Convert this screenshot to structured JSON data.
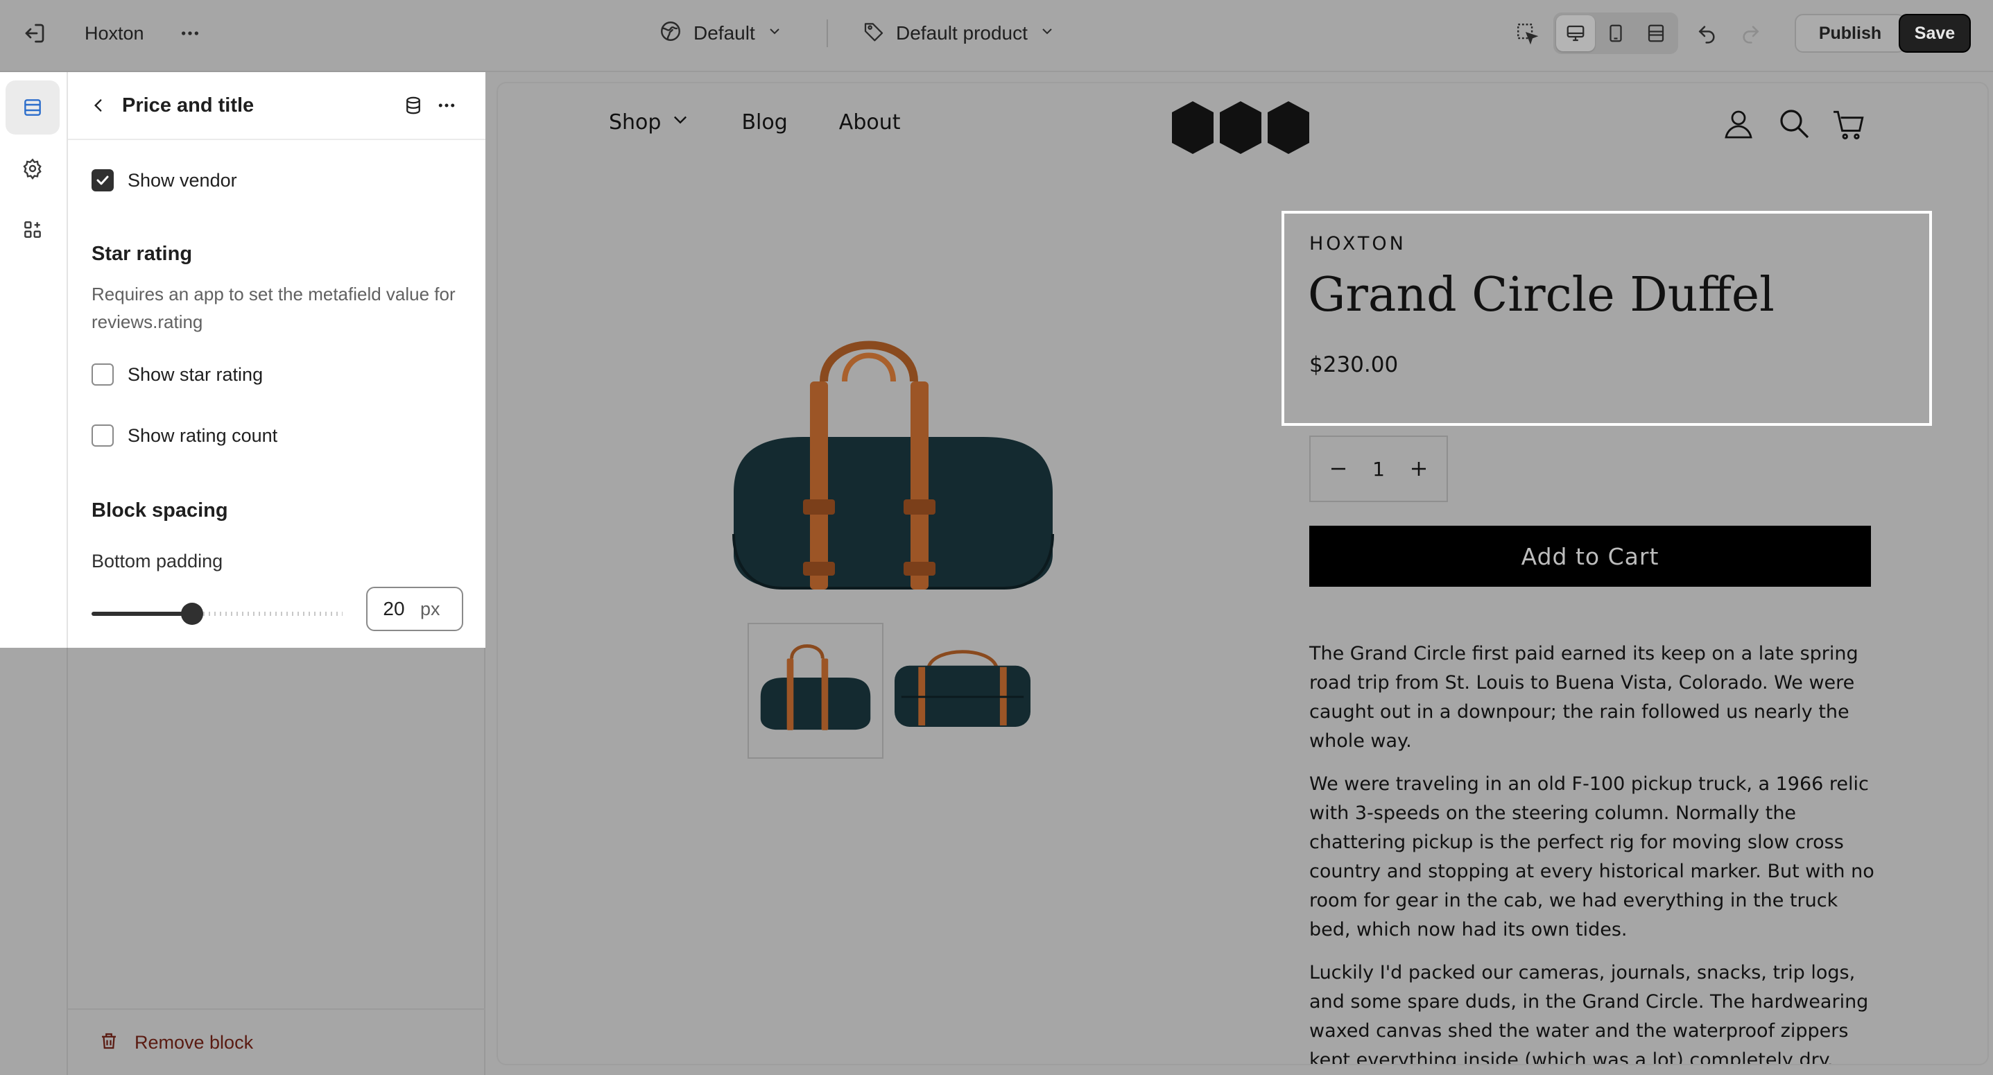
{
  "topbar": {
    "store_name": "Hoxton",
    "theme": "Default",
    "template": "Default product",
    "publish_label": "Publish",
    "save_label": "Save"
  },
  "panel": {
    "title": "Price and title",
    "show_vendor_label": "Show vendor",
    "show_vendor_checked": true,
    "star_rating_heading": "Star rating",
    "star_rating_help": "Requires an app to set the metafield value for reviews.rating",
    "show_star_rating_label": "Show star rating",
    "show_rating_count_label": "Show rating count",
    "block_spacing_heading": "Block spacing",
    "bottom_padding_label": "Bottom padding",
    "bottom_padding_value": "20",
    "bottom_padding_unit": "px",
    "slider_fraction": 0.4,
    "remove_label": "Remove block"
  },
  "preview": {
    "nav": {
      "shop": "Shop",
      "blog": "Blog",
      "about": "About"
    },
    "vendor": "HOXTON",
    "title": "Grand Circle Duffel",
    "price": "$230.00",
    "quantity": "1",
    "add_to_cart": "Add to Cart",
    "description": [
      "The Grand Circle first paid earned its keep on a late spring road trip from St. Louis to Buena Vista, Colorado. We were caught out in a downpour; the rain followed us nearly the whole way.",
      "We were traveling in an old F-100 pickup truck, a 1966 relic with 3-speeds on the steering column. Normally the chattering pickup is the perfect rig for moving slow cross country and stopping at every historical marker. But with no room for gear in the cab, we had everything in the truck bed, which now had its own tides.",
      "Luckily I'd packed our cameras, journals, snacks, trip logs, and some spare duds, in the Grand Circle. The hardwearing waxed canvas shed the water and the waterproof zippers kept everything inside (which was a lot) completely dry."
    ]
  },
  "colors": {
    "overlay": "#a6a6a6",
    "panel_bg": "#ffffff",
    "accent_dark": "#303030",
    "remove_text": "#5a1b12",
    "selection_outline": "#ffffff"
  },
  "icons": [
    "exit-icon",
    "more-icon",
    "globe-icon",
    "chevron-down-icon",
    "tag-icon",
    "inspector-icon",
    "desktop-icon",
    "mobile-icon",
    "fullwidth-icon",
    "undo-icon",
    "redo-icon",
    "sections-icon",
    "gear-icon",
    "apps-icon",
    "back-icon",
    "database-icon",
    "trash-icon",
    "account-icon",
    "search-icon",
    "cart-icon",
    "minus-icon",
    "plus-icon"
  ]
}
